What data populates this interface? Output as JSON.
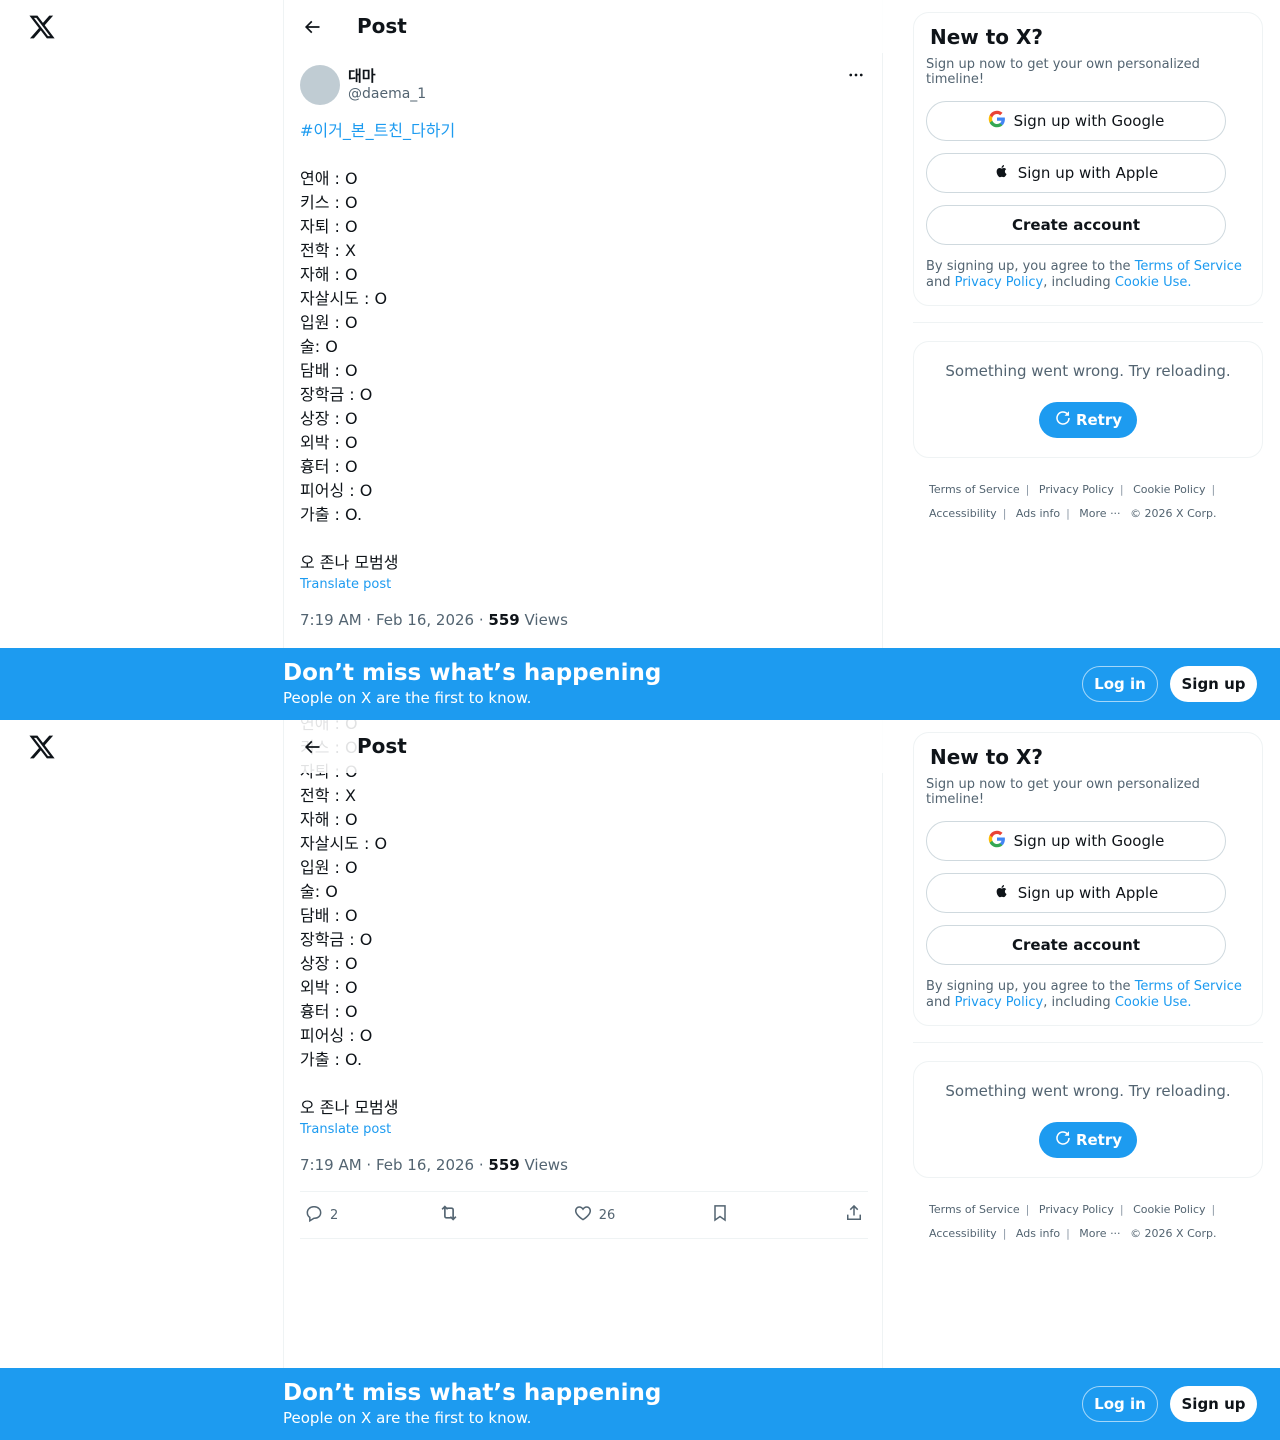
{
  "header": {
    "title": "Post"
  },
  "post": {
    "author_name": "대마",
    "author_handle": "@daema_1",
    "hashtag": "#이거_본_트친_다하기",
    "lines": [
      "연애 : O",
      "키스 : O",
      "자퇴 : O",
      "전학 : X",
      "자해 : O",
      "자살시도 : O",
      "입원 : O",
      "술: O",
      "담배 : O",
      "장학금 : O",
      "상장 : O",
      "외박 : O",
      "흉터 : O",
      "피어싱 : O",
      "가출 : O."
    ],
    "closing": "오 존나 모범생",
    "translate_label": "Translate post",
    "timestamp": "7:19 AM · Feb 16, 2026 · ",
    "views_count": "559",
    "views_label": " Views"
  },
  "actions": {
    "replies": "2",
    "likes": "26"
  },
  "sidebar": {
    "title": "New to X?",
    "subtitle": "Sign up now to get your own personalized timeline!",
    "google_label": "Sign up with Google",
    "apple_label": "Sign up with Apple",
    "create_label": "Create account",
    "terms_prefix": "By signing up, you agree to the ",
    "terms_link": "Terms of Service",
    "terms_and": " and ",
    "privacy_link": "Privacy Policy",
    "terms_including": ", including ",
    "cookie_link": "Cookie Use."
  },
  "error": {
    "message": "Something went wrong. Try reloading.",
    "retry_label": "Retry"
  },
  "footer": {
    "terms": "Terms of Service",
    "privacy": "Privacy Policy",
    "cookie": "Cookie Policy",
    "accessibility": "Accessibility",
    "ads": "Ads info",
    "more": "More ···",
    "copyright": "© 2026 X Corp."
  },
  "banner": {
    "title": "Don’t miss what’s happening",
    "subtitle": "People on X are the first to know.",
    "login_label": "Log in",
    "signup_label": "Sign up"
  },
  "colors": {
    "accent": "#1d9bf0",
    "text": "#0f1419",
    "muted": "#536471",
    "border": "#eff3f4"
  }
}
